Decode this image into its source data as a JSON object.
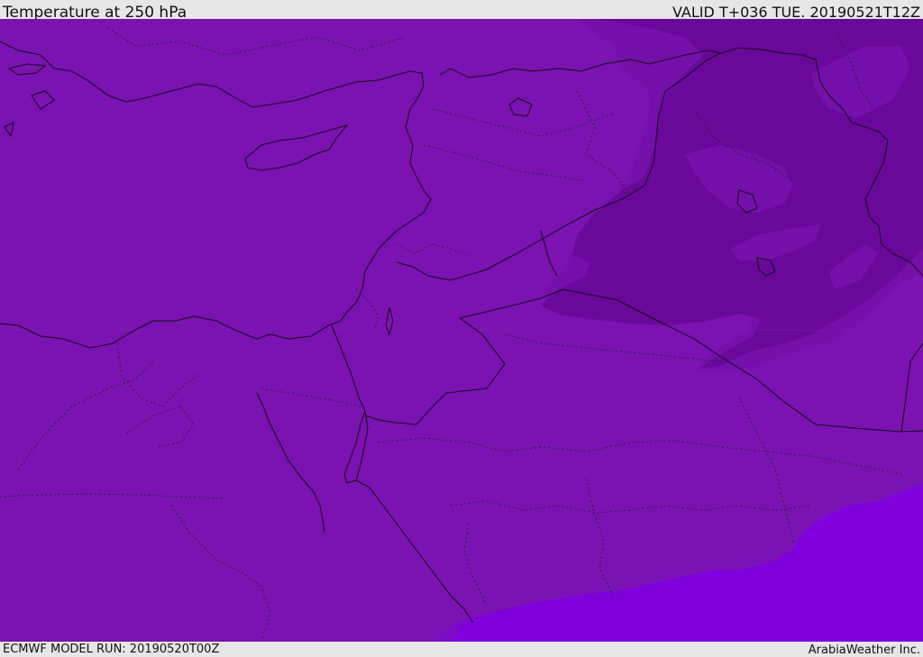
{
  "header": {
    "title": "Temperature at 250 hPa",
    "valid_time": "VALID T+036 TUE. 20190521T12Z"
  },
  "footer": {
    "model_run": "ECMWF MODEL RUN: 20190520T00Z",
    "credit": "ArabiaWeather Inc."
  },
  "map": {
    "colors": {
      "base_fill": "#7b12b1",
      "cold_zone_light": "#7510ab",
      "cold_zone_dark": "#69089a",
      "warm_zone": "#7f00dd",
      "coastline": "#111111",
      "border": "#111111",
      "province_line": "#222222"
    }
  }
}
